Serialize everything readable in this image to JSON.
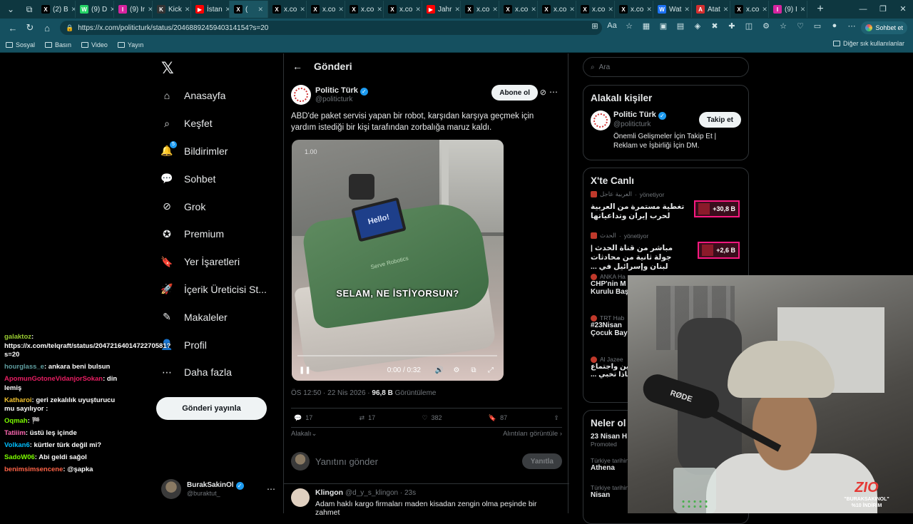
{
  "browser": {
    "tabs": [
      {
        "label": "(2) B",
        "fav_color": "#000000",
        "fav": "X"
      },
      {
        "label": "(9) D",
        "fav_color": "#25d366",
        "fav": "W"
      },
      {
        "label": "(9) Ir",
        "fav_color": "#d6249f",
        "fav": "I"
      },
      {
        "label": "Kick",
        "fav_color": "#333333",
        "fav": "K"
      },
      {
        "label": "İstan",
        "fav_color": "#ff0000",
        "fav": "▶"
      },
      {
        "label": "(",
        "fav_color": "#000000",
        "fav": "X"
      },
      {
        "label": "x.co",
        "fav_color": "#000000",
        "fav": "X"
      },
      {
        "label": "x.co",
        "fav_color": "#000000",
        "fav": "X"
      },
      {
        "label": "x.co",
        "fav_color": "#000000",
        "fav": "X"
      },
      {
        "label": "x.co",
        "fav_color": "#000000",
        "fav": "X"
      },
      {
        "label": "Jahr",
        "fav_color": "#ff0000",
        "fav": "▶"
      },
      {
        "label": "x.co",
        "fav_color": "#000000",
        "fav": "X"
      },
      {
        "label": "x.co",
        "fav_color": "#000000",
        "fav": "X"
      },
      {
        "label": "x.co",
        "fav_color": "#000000",
        "fav": "X"
      },
      {
        "label": "x.co",
        "fav_color": "#000000",
        "fav": "X"
      },
      {
        "label": "x.co",
        "fav_color": "#000000",
        "fav": "X"
      },
      {
        "label": "Wat",
        "fav_color": "#1d72f3",
        "fav": "W"
      },
      {
        "label": "Atat",
        "fav_color": "#d32f2f",
        "fav": "A"
      },
      {
        "label": "x.co",
        "fav_color": "#000000",
        "fav": "X"
      },
      {
        "label": "(9) I",
        "fav_color": "#d6249f",
        "fav": "I"
      }
    ],
    "url": "https://x.com/politicturk/status/2046889245940314154?s=20",
    "chat_button": "Sohbet et",
    "bookmarks": [
      "Sosyal",
      "Basın",
      "Video",
      "Yayın"
    ],
    "bookmarks_right": "Diğer sık kullanılanlar"
  },
  "nav": {
    "items": [
      {
        "label": "Anasayfa",
        "icon": "home-icon"
      },
      {
        "label": "Keşfet",
        "icon": "search-icon"
      },
      {
        "label": "Bildirimler",
        "icon": "bell-icon",
        "badge": "5"
      },
      {
        "label": "Sohbet",
        "icon": "chat-icon"
      },
      {
        "label": "Grok",
        "icon": "grok-icon"
      },
      {
        "label": "Premium",
        "icon": "premium-icon"
      },
      {
        "label": "Yer İşaretleri",
        "icon": "bookmark-icon"
      },
      {
        "label": "İçerik Üreticisi St...",
        "icon": "rocket-icon"
      },
      {
        "label": "Makaleler",
        "icon": "article-icon"
      },
      {
        "label": "Profil",
        "icon": "profile-icon"
      },
      {
        "label": "Daha fazla",
        "icon": "more-circle-icon"
      }
    ],
    "post_button": "Gönderi yayınla",
    "profile_name": "BurakSakinOl",
    "profile_handle": "@buraktut_"
  },
  "post": {
    "header": "Gönderi",
    "author": "Politic Türk",
    "handle": "@politicturk",
    "subscribe": "Abone ol",
    "text": "ABD'de paket servisi yapan bir robot, karşıdan karşıya geçmek için yardım istediği bir kişi tarafından zorbalığa maruz kaldı.",
    "video": {
      "speed": "1.00",
      "caption": "SELAM, NE İSTİYORSUN?",
      "screen_text": "Hello!",
      "brand_text": "Serve Robotics",
      "time": "0:00 / 0:32",
      "progress": 0
    },
    "time": "ÖS 12:50 · 22 Nis 2026 · ",
    "views": "96,8 B",
    "views_label": " Görüntüleme",
    "replies": "17",
    "reposts": "17",
    "likes": "382",
    "bookmarks": "87",
    "related": "Alakalı",
    "quotes": "Alıntıları görüntüle",
    "reply_placeholder": "Yanıtını gönder",
    "reply_button": "Yanıtla"
  },
  "reply": {
    "name": "Klingon",
    "handle": "@d_y_s_klingon · 23s",
    "text": "Adam haklı kargo firmaları maden kisadan zengin olma peşinde bir zahmet"
  },
  "right": {
    "search_placeholder": "Ara",
    "related_title": "Alakalı kişiler",
    "related_person": {
      "name": "Politic Türk",
      "handle": "@politicturk",
      "bio": "Önemli Gelişmeler İçin Takip Et | Reklam ve İşbirliği İçin DM.",
      "follow": "Takip et"
    },
    "live_title": "X'te Canlı",
    "live": [
      {
        "source": "العربية عاجل",
        "status": "yönetiyor",
        "title": "تغطية مستمرة من العربية لحرب إيران وتداعياتها",
        "count": "+30,8 B"
      },
      {
        "source": "الحدث",
        "status": "yönetiyor",
        "title": "مباشر من قناة الحدث | جولة ثانية من محادثات لبنان وإسرائيل في ...",
        "count": "+2,6 B"
      }
    ],
    "trends": [
      {
        "source": "ANKA Ha",
        "title": "CHP'nin M",
        "title2": "Kurulu Baş"
      },
      {
        "source": "TRT Hab",
        "title": "#23Nisan",
        "title2": "Çocuk Bay"
      },
      {
        "source": "Al Jazee",
        "title": "مين واجتماع",
        "title2": "... ماذا تخبي"
      }
    ],
    "news_title": "Neler ol",
    "news": [
      {
        "title": "23 Nisan H",
        "sub": "Promoted"
      },
      {
        "meta": "Türkiye tarihinde gündemde",
        "title": "Athena"
      },
      {
        "meta": "Türkiye tarihinde gündemde",
        "title": "Nisan"
      }
    ]
  },
  "chat": [
    {
      "user": "galaktoz",
      "color": "#9acd32",
      "text": "https://x.com/telqraft/status/2047216401472270581?s=20"
    },
    {
      "user": "hourglass_e",
      "color": "#5f9ea0",
      "text": "ankara beni bulsun"
    },
    {
      "user": "ApomunGotoneVidanjorSokan",
      "color": "#e91e63",
      "text": "din lemiş"
    },
    {
      "user": "Katharoi",
      "color": "#f4c430",
      "text": "geri zekalılık uyuşturucu mu sayılıyor :"
    },
    {
      "user": "Oqmah",
      "color": "#7cfc00",
      "text": "🏁"
    },
    {
      "user": "Tatiiim",
      "color": "#ff69b4",
      "text": "üstü leş içinde"
    },
    {
      "user": "Volkan6",
      "color": "#00bfff",
      "text": "kürtler türk değil mi?"
    },
    {
      "user": "SadoW06",
      "color": "#7cfc00",
      "text": "Abi geldi sağol"
    },
    {
      "user": "benimsimsencene",
      "color": "#ff6347",
      "text": "@şapka"
    }
  ],
  "overlay": {
    "mic_brand": "RØDE",
    "promo_logo": "ZIO",
    "promo_code": "\"BURAKSAKINOL\"",
    "promo_discount": "%10 İNDİRİM"
  }
}
